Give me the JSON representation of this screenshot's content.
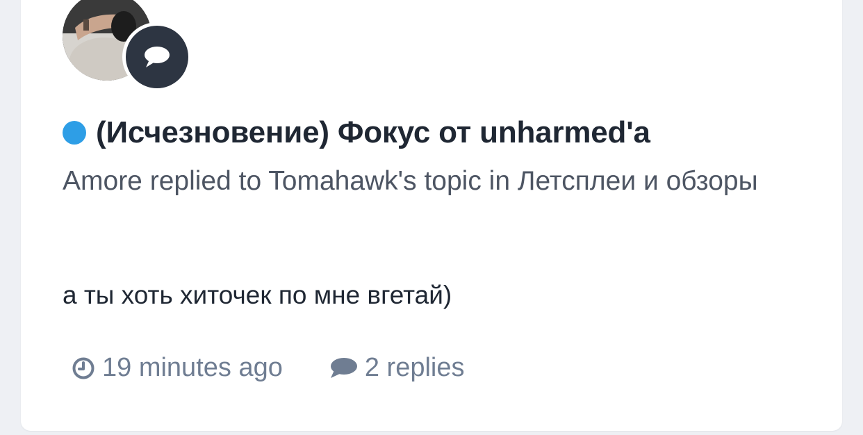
{
  "notification": {
    "title": "(Исчезновение) Фокус от unharmed'a",
    "unread": true,
    "meta": "Amore replied to Tomahawk's topic in Летсплеи и обзоры",
    "snippet": "а ты хоть хиточек по мне вгетай)",
    "time": "19 minutes ago",
    "replies": "2 replies",
    "type_icon": "speech-bubble-icon"
  },
  "colors": {
    "unread_dot": "#2e9ee6",
    "badge_bg": "#2d3542",
    "title": "#1f2733",
    "meta": "#4d5563",
    "stats": "#6f7d92"
  }
}
